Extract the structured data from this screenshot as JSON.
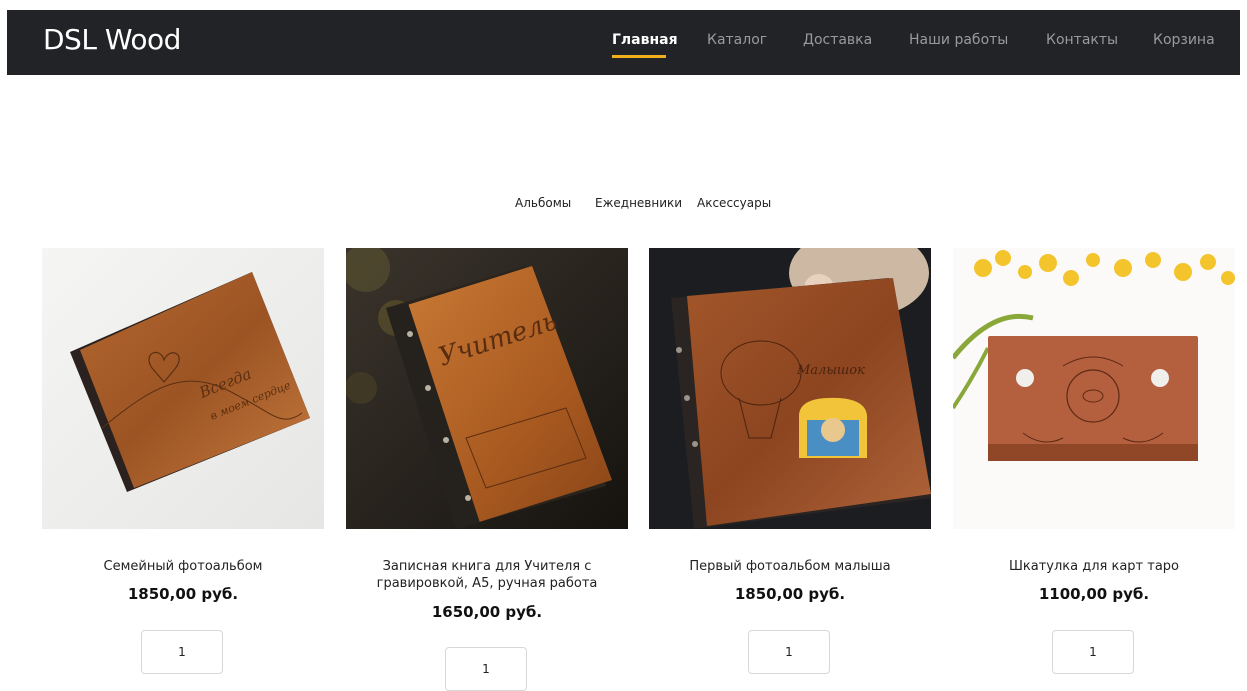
{
  "header": {
    "logo": "DSL Wood",
    "nav": [
      {
        "label": "Главная",
        "active": true
      },
      {
        "label": "Каталог",
        "active": false
      },
      {
        "label": "Доставка",
        "active": false
      },
      {
        "label": "Наши работы",
        "active": false
      },
      {
        "label": "Контакты",
        "active": false
      },
      {
        "label": "Корзина",
        "active": false
      }
    ],
    "accent_color": "#f0b01c",
    "background": "#212326"
  },
  "category_tabs": [
    "Альбомы",
    "Ежедневники",
    "Аксессуары"
  ],
  "products": [
    {
      "title": "Семейный фотоальбом",
      "price": "1850,00 руб.",
      "qty": "1"
    },
    {
      "title": "Записная книга для Учителя с гравировкой, А5, ручная работа",
      "price": "1650,00 руб.",
      "qty": "1"
    },
    {
      "title": "Первый фотоальбом малыша",
      "price": "1850,00 руб.",
      "qty": "1"
    },
    {
      "title": "Шкатулка для карт таро",
      "price": "1100,00 руб.",
      "qty": "1"
    }
  ]
}
